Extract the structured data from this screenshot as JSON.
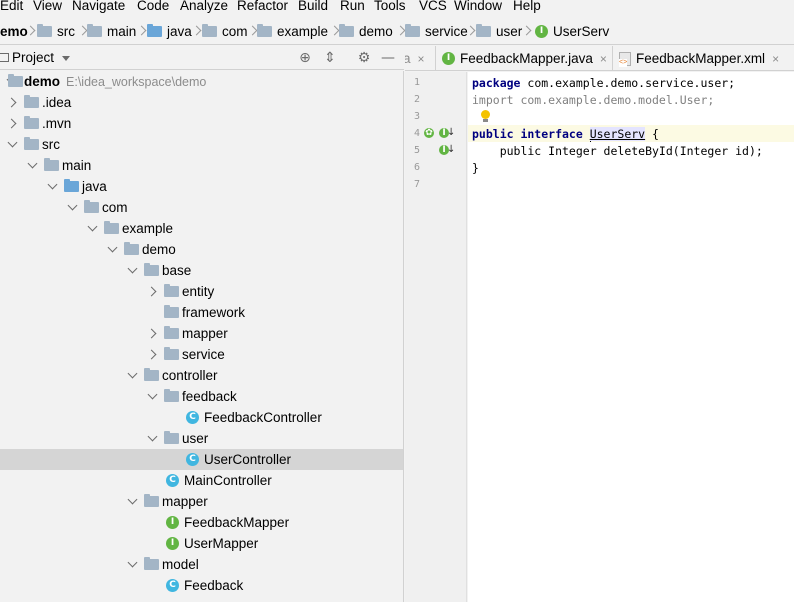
{
  "menu": [
    "Edit",
    "View",
    "Navigate",
    "Code",
    "Analyze",
    "Refactor",
    "Build",
    "Run",
    "Tools",
    "VCS",
    "Window",
    "Help"
  ],
  "breadcrumb": [
    "emo",
    "src",
    "main",
    "java",
    "com",
    "example",
    "demo",
    "service",
    "user",
    "UserServ"
  ],
  "project_panel": {
    "title": "Project",
    "root_name": "demo",
    "root_path": "E:\\idea_workspace\\demo",
    "items": [
      ".idea",
      ".mvn",
      "src",
      "main",
      "java",
      "com",
      "example",
      "demo",
      "base",
      "entity",
      "framework",
      "mapper",
      "service",
      "controller",
      "feedback",
      "FeedbackController",
      "user",
      "UserController",
      "MainController",
      "mapper",
      "FeedbackMapper",
      "UserMapper",
      "model",
      "Feedback"
    ]
  },
  "editor": {
    "tabs": [
      {
        "label": "a",
        "close": "×"
      },
      {
        "label": "FeedbackMapper.java",
        "close": "×"
      },
      {
        "label": "FeedbackMapper.xml",
        "close": "×"
      }
    ],
    "line_numbers": [
      "1",
      "2",
      "3",
      "4",
      "5",
      "6",
      "7"
    ],
    "code": {
      "l1_kw": "package",
      "l1_rest": " com.example.demo.service.user;",
      "l2": "import com.example.demo.model.User;",
      "l4_kw": "public interface ",
      "l4_name": "UserServ",
      "l4_rest": " {",
      "l5": "    public Integer deleteById(Integer id);",
      "l6": "}"
    }
  }
}
